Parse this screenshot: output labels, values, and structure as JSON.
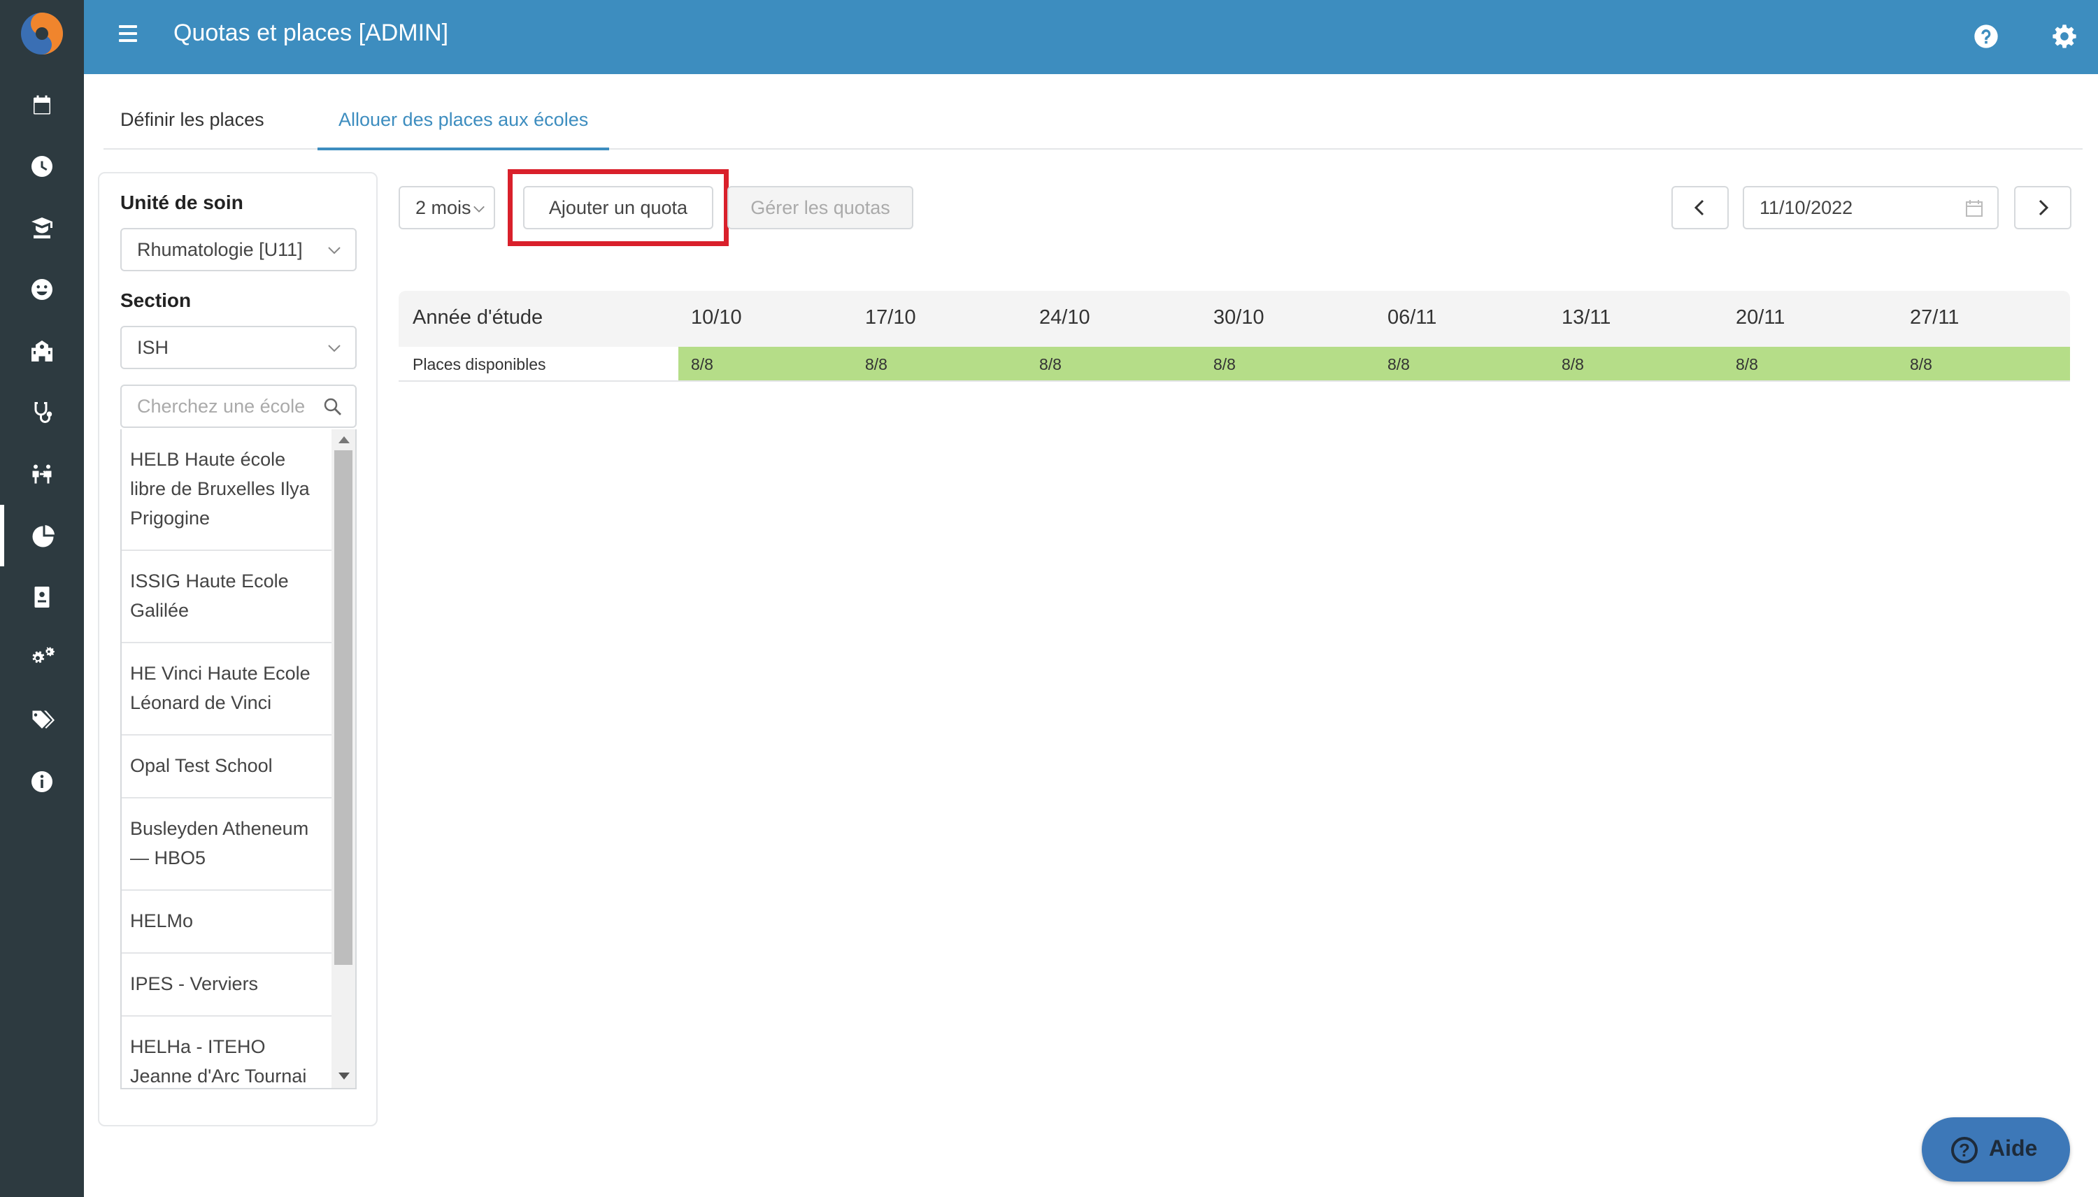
{
  "header": {
    "title": "Quotas et places [ADMIN]",
    "help_icon": "help-circle-icon",
    "settings_icon": "gear-icon"
  },
  "sidebar": {
    "icons": [
      "calendar-icon",
      "clock-icon",
      "graduate-icon",
      "smiley-icon",
      "school-icon",
      "stethoscope-icon",
      "people-exchange-icon",
      "pie-chart-icon",
      "id-badge-icon",
      "gears-icon",
      "tags-icon",
      "info-icon"
    ],
    "active": "pie-chart-icon"
  },
  "tabs": [
    {
      "label": "Définir les places",
      "active": false
    },
    {
      "label": "Allouer des places aux écoles",
      "active": true
    }
  ],
  "filters": {
    "unit_label": "Unité de soin",
    "unit_value": "Rhumatologie [U11]",
    "section_label": "Section",
    "section_value": "ISH",
    "search_placeholder": "Cherchez une école",
    "schools": [
      "HELB Haute école libre de Bruxelles Ilya Prigogine",
      "ISSIG Haute Ecole Galilée",
      "HE Vinci Haute Ecole Léonard de Vinci",
      "Opal Test School",
      "Busleyden Atheneum — HBO5",
      "HELMo",
      "IPES - Verviers",
      "HELHa - ITEHO Jeanne d'Arc Tournai"
    ]
  },
  "toolbar": {
    "period": "2 mois",
    "add_quota": "Ajouter un quota",
    "manage_quotas": "Gérer les quotas",
    "date": "11/10/2022"
  },
  "quota_table": {
    "row_header": "Année d'étude",
    "row_label": "Places disponibles",
    "weeks": [
      "10/10",
      "17/10",
      "24/10",
      "30/10",
      "06/11",
      "13/11",
      "20/11",
      "27/11"
    ],
    "values": [
      "8/8",
      "8/8",
      "8/8",
      "8/8",
      "8/8",
      "8/8",
      "8/8",
      "8/8"
    ],
    "availability_color": "#b5dd88"
  },
  "help_button": {
    "label": "Aide"
  },
  "colors": {
    "header": "#3d8dbf",
    "rail": "#2d3a40",
    "highlight": "#d9202b"
  }
}
